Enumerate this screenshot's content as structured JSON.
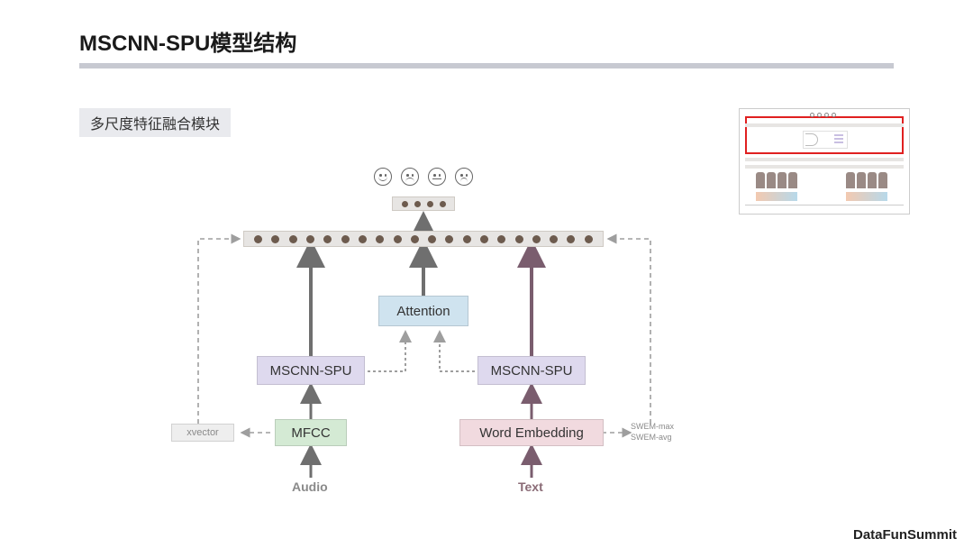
{
  "title": "MSCNN-SPU模型结构",
  "subtitle": "多尺度特征融合模块",
  "watermark": "DataFunSummit",
  "diagram": {
    "output_emojis": [
      "smile",
      "frown",
      "flat",
      "sad"
    ],
    "fusion_bar_dots": 20,
    "small_bar_dots": 4,
    "blocks": {
      "attention": "Attention",
      "mscnn_left": "MSCNN-SPU",
      "mscnn_right": "MSCNN-SPU",
      "mfcc": "MFCC",
      "word_emb": "Word Embedding"
    },
    "side_labels": {
      "xvector": "xvector",
      "swem_max": "SWEM-max",
      "swem_avg": "SWEM-avg"
    },
    "inputs": {
      "audio": "Audio",
      "text": "Text"
    }
  },
  "colors": {
    "attention_bg": "#cfe3ef",
    "mscnn_bg": "#ded9ee",
    "mfcc_bg": "#d4ead4",
    "wordemb_bg": "#f1dadf",
    "xvector_bg": "#eeeeee"
  }
}
